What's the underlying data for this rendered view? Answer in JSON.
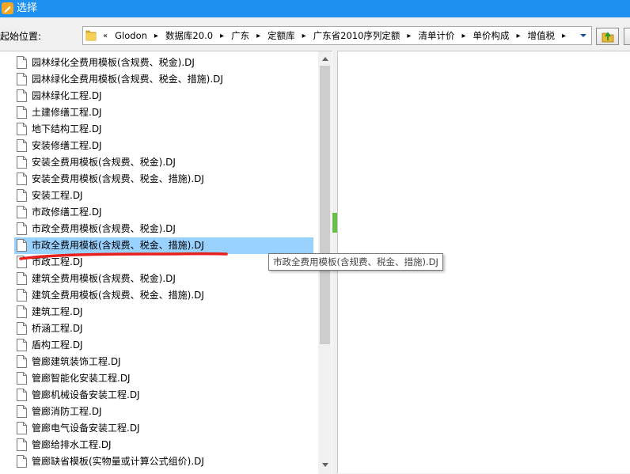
{
  "window": {
    "title": "选择"
  },
  "location": {
    "label": "起始位置:",
    "breadcrumbs": [
      "Glodon",
      "数据库20.0",
      "广东",
      "定额库",
      "广东省2010序列定额",
      "清单计价",
      "单价构成",
      "增值税"
    ]
  },
  "files": [
    "园林绿化全费用模板(含规费、税金).DJ",
    "园林绿化全费用模板(含规费、税金、措施).DJ",
    "园林绿化工程.DJ",
    "土建修缮工程.DJ",
    "地下结构工程.DJ",
    "安装修缮工程.DJ",
    "安装全费用模板(含规费、税金).DJ",
    "安装全费用模板(含规费、税金、措施).DJ",
    "安装工程.DJ",
    "市政修缮工程.DJ",
    "市政全费用模板(含规费、税金).DJ",
    "市政全费用模板(含规费、税金、措施).DJ",
    "市政工程.DJ",
    "建筑全费用模板(含规费、税金).DJ",
    "建筑全费用模板(含规费、税金、措施).DJ",
    "建筑工程.DJ",
    "桥涵工程.DJ",
    "盾构工程.DJ",
    "管廊建筑装饰工程.DJ",
    "管廊智能化安装工程.DJ",
    "管廊机械设备安装工程.DJ",
    "管廊消防工程.DJ",
    "管廊电气设备安装工程.DJ",
    "管廊给排水工程.DJ",
    "管廊缺省模板(实物量或计算公式组价).DJ"
  ],
  "selected_index": 11,
  "tooltip": {
    "text": "市政全费用模板(含规费、税金、措施).DJ"
  },
  "colors": {
    "titlebar": "#1e90f0",
    "selection": "#99d1ff",
    "annotation": "#e8201c",
    "splitter": "#6abf4b"
  }
}
